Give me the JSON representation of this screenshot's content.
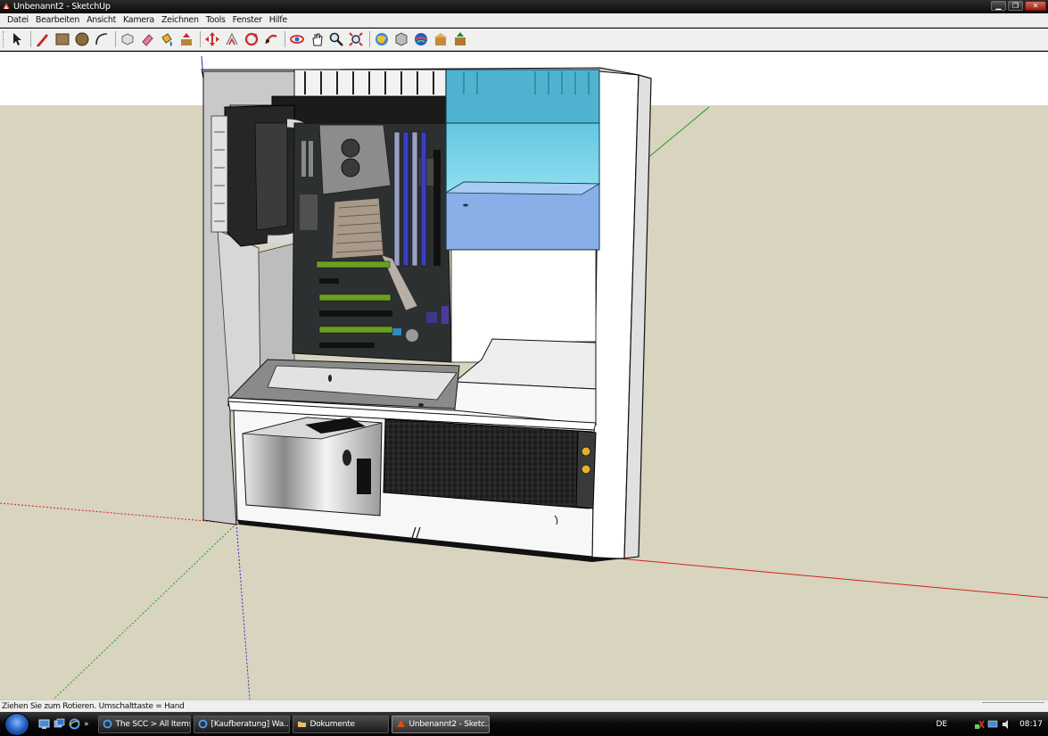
{
  "window": {
    "title": "Unbenannt2 - SketchUp",
    "controls": [
      "minimize",
      "maximize",
      "close"
    ]
  },
  "menu": [
    "Datei",
    "Bearbeiten",
    "Ansicht",
    "Kamera",
    "Zeichnen",
    "Tools",
    "Fenster",
    "Hilfe"
  ],
  "toolbar": {
    "tools": [
      "select-icon",
      "line-pencil-icon",
      "rectangle-icon",
      "circle-icon",
      "arc-icon",
      "make-component-icon",
      "eraser-icon",
      "paint-bucket-icon",
      "push-pull-icon",
      "move-icon",
      "offset-icon",
      "rotate-icon",
      "follow-me-icon",
      "orbit-icon",
      "pan-icon",
      "zoom-icon",
      "zoom-extents-icon",
      "get-models-icon",
      "share-model-icon",
      "google-earth-icon",
      "warehouse-component-icon",
      "share-component-icon"
    ]
  },
  "viewport": {
    "background": {
      "sky": "#ffffff",
      "ground": "#d8d4bf"
    },
    "axis_colors": {
      "red": "#d22222",
      "green": "#1e9e1e",
      "blue": "#2a2ad0"
    }
  },
  "status": {
    "text": "Ziehen Sie zum Rotieren. Umschalttaste = Hand"
  },
  "taskbar": {
    "tasks": [
      {
        "label": "The SCC > All Items ...",
        "icon": "internet-explorer-icon",
        "active": false
      },
      {
        "label": "[Kaufberatung] Wa...",
        "icon": "internet-explorer-icon",
        "active": false
      },
      {
        "label": "Dokumente",
        "icon": "folder-icon",
        "active": false
      },
      {
        "label": "Unbenannt2 - Sketc...",
        "icon": "sketchup-icon",
        "active": true
      }
    ],
    "overflow": "»",
    "language": "DE",
    "clock": "08:17"
  }
}
